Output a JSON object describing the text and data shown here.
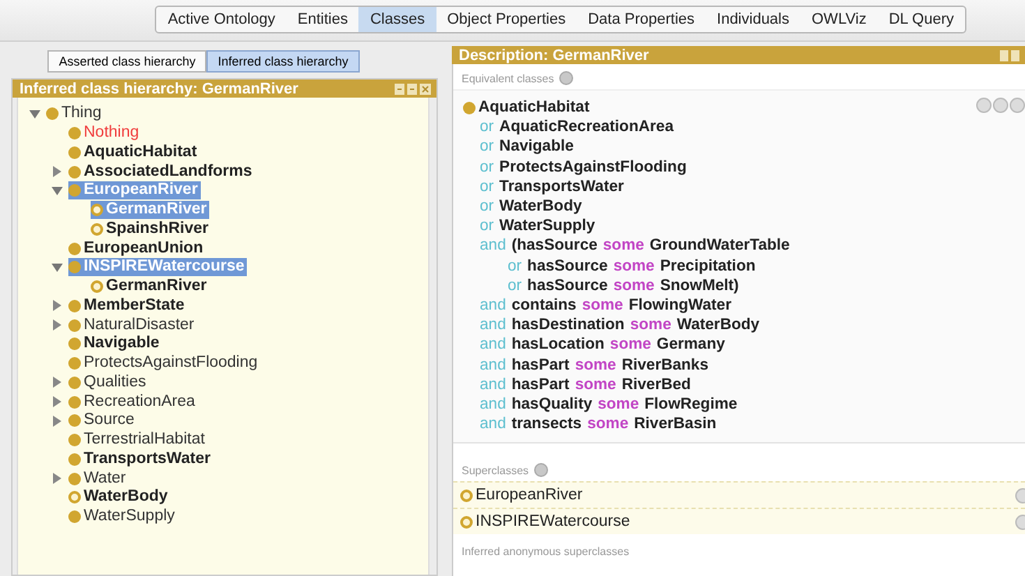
{
  "tabs": [
    {
      "label": "Active Ontology",
      "selected": false
    },
    {
      "label": "Entities",
      "selected": false
    },
    {
      "label": "Classes",
      "selected": true
    },
    {
      "label": "Object Properties",
      "selected": false
    },
    {
      "label": "Data Properties",
      "selected": false
    },
    {
      "label": "Individuals",
      "selected": false
    },
    {
      "label": "OWLViz",
      "selected": false
    },
    {
      "label": "DL Query",
      "selected": false
    }
  ],
  "left": {
    "view_buttons": [
      {
        "label": "Asserted class hierarchy",
        "selected": false
      },
      {
        "label": "Inferred class hierarchy",
        "selected": true
      }
    ],
    "title": "Inferred class hierarchy: GermanRiver",
    "tree": [
      {
        "label": "Thing",
        "kind": "class",
        "bold": false,
        "defined": false,
        "selected": false,
        "expanded": true,
        "children": [
          {
            "label": "Nothing",
            "kind": "nothing",
            "bold": false,
            "defined": false,
            "selected": false
          },
          {
            "label": "AquaticHabitat",
            "kind": "class",
            "bold": true,
            "defined": false,
            "selected": false
          },
          {
            "label": "AssociatedLandforms",
            "kind": "class",
            "bold": true,
            "defined": false,
            "selected": false,
            "expanded": false
          },
          {
            "label": "EuropeanRiver",
            "kind": "class",
            "bold": true,
            "defined": false,
            "selected": true,
            "expanded": true,
            "children": [
              {
                "label": "GermanRiver",
                "kind": "class",
                "bold": true,
                "defined": true,
                "selected": true
              },
              {
                "label": "SpainshRiver",
                "kind": "class",
                "bold": true,
                "defined": true,
                "selected": false
              }
            ]
          },
          {
            "label": "EuropeanUnion",
            "kind": "class",
            "bold": true,
            "defined": false,
            "selected": false
          },
          {
            "label": "INSPIREWatercourse",
            "kind": "class",
            "bold": true,
            "defined": false,
            "selected": true,
            "expanded": true,
            "children": [
              {
                "label": "GermanRiver",
                "kind": "class",
                "bold": true,
                "defined": true,
                "selected": false
              }
            ]
          },
          {
            "label": "MemberState",
            "kind": "class",
            "bold": true,
            "defined": false,
            "selected": false,
            "expanded": false
          },
          {
            "label": "NaturalDisaster",
            "kind": "class",
            "bold": false,
            "defined": false,
            "selected": false,
            "expanded": false
          },
          {
            "label": "Navigable",
            "kind": "class",
            "bold": true,
            "defined": false,
            "selected": false
          },
          {
            "label": "ProtectsAgainstFlooding",
            "kind": "class",
            "bold": false,
            "defined": false,
            "selected": false
          },
          {
            "label": "Qualities",
            "kind": "class",
            "bold": false,
            "defined": false,
            "selected": false,
            "expanded": false
          },
          {
            "label": "RecreationArea",
            "kind": "class",
            "bold": false,
            "defined": false,
            "selected": false,
            "expanded": false
          },
          {
            "label": "Source",
            "kind": "class",
            "bold": false,
            "defined": false,
            "selected": false,
            "expanded": false
          },
          {
            "label": "TerrestrialHabitat",
            "kind": "class",
            "bold": false,
            "defined": false,
            "selected": false
          },
          {
            "label": "TransportsWater",
            "kind": "class",
            "bold": true,
            "defined": false,
            "selected": false
          },
          {
            "label": "Water",
            "kind": "class",
            "bold": false,
            "defined": false,
            "selected": false,
            "expanded": false
          },
          {
            "label": "WaterBody",
            "kind": "class",
            "bold": true,
            "defined": true,
            "selected": false
          },
          {
            "label": "WaterSupply",
            "kind": "class",
            "bold": false,
            "defined": false,
            "selected": false
          }
        ]
      }
    ]
  },
  "right": {
    "title": "Description: GermanRiver",
    "equivalent": {
      "label": "Equivalent classes",
      "lines": [
        {
          "kind": "head",
          "parts": [
            {
              "text": "AquaticHabitat",
              "kind": "name"
            }
          ]
        },
        {
          "kind": "main",
          "parts": [
            {
              "text": "or",
              "kind": "keyword"
            },
            {
              "text": "AquaticRecreationArea",
              "kind": "name"
            }
          ]
        },
        {
          "kind": "main",
          "parts": [
            {
              "text": "or",
              "kind": "keyword"
            },
            {
              "text": "Navigable",
              "kind": "name"
            }
          ]
        },
        {
          "kind": "main",
          "parts": [
            {
              "text": "or",
              "kind": "keyword"
            },
            {
              "text": "ProtectsAgainstFlooding",
              "kind": "name"
            }
          ]
        },
        {
          "kind": "main",
          "parts": [
            {
              "text": "or",
              "kind": "keyword"
            },
            {
              "text": "TransportsWater",
              "kind": "name"
            }
          ]
        },
        {
          "kind": "main",
          "parts": [
            {
              "text": "or",
              "kind": "keyword"
            },
            {
              "text": "WaterBody",
              "kind": "name"
            }
          ]
        },
        {
          "kind": "main",
          "parts": [
            {
              "text": "or",
              "kind": "keyword"
            },
            {
              "text": "WaterSupply",
              "kind": "name"
            }
          ]
        },
        {
          "kind": "main",
          "parts": [
            {
              "text": "and",
              "kind": "keyword"
            },
            {
              "text": "(hasSource",
              "kind": "name"
            },
            {
              "text": "some",
              "kind": "quantifier"
            },
            {
              "text": "GroundWaterTable",
              "kind": "name"
            }
          ]
        },
        {
          "kind": "sub",
          "parts": [
            {
              "text": "or",
              "kind": "keyword"
            },
            {
              "text": "hasSource",
              "kind": "name"
            },
            {
              "text": "some",
              "kind": "quantifier"
            },
            {
              "text": "Precipitation",
              "kind": "name"
            }
          ]
        },
        {
          "kind": "sub",
          "parts": [
            {
              "text": "or",
              "kind": "keyword"
            },
            {
              "text": "hasSource",
              "kind": "name"
            },
            {
              "text": "some",
              "kind": "quantifier"
            },
            {
              "text": "SnowMelt)",
              "kind": "name"
            }
          ]
        },
        {
          "kind": "main",
          "parts": [
            {
              "text": "and",
              "kind": "keyword"
            },
            {
              "text": "contains",
              "kind": "name"
            },
            {
              "text": "some",
              "kind": "quantifier"
            },
            {
              "text": "FlowingWater",
              "kind": "name"
            }
          ]
        },
        {
          "kind": "main",
          "parts": [
            {
              "text": "and",
              "kind": "keyword"
            },
            {
              "text": "hasDestination",
              "kind": "name"
            },
            {
              "text": "some",
              "kind": "quantifier"
            },
            {
              "text": "WaterBody",
              "kind": "name"
            }
          ]
        },
        {
          "kind": "main",
          "parts": [
            {
              "text": "and",
              "kind": "keyword"
            },
            {
              "text": "hasLocation",
              "kind": "name"
            },
            {
              "text": "some",
              "kind": "quantifier"
            },
            {
              "text": "Germany",
              "kind": "name"
            }
          ]
        },
        {
          "kind": "main",
          "parts": [
            {
              "text": "and",
              "kind": "keyword"
            },
            {
              "text": "hasPart",
              "kind": "name"
            },
            {
              "text": "some",
              "kind": "quantifier"
            },
            {
              "text": "RiverBanks",
              "kind": "name"
            }
          ]
        },
        {
          "kind": "main",
          "parts": [
            {
              "text": "and",
              "kind": "keyword"
            },
            {
              "text": "hasPart",
              "kind": "name"
            },
            {
              "text": "some",
              "kind": "quantifier"
            },
            {
              "text": "RiverBed",
              "kind": "name"
            }
          ]
        },
        {
          "kind": "main",
          "parts": [
            {
              "text": "and",
              "kind": "keyword"
            },
            {
              "text": "hasQuality",
              "kind": "name"
            },
            {
              "text": "some",
              "kind": "quantifier"
            },
            {
              "text": "FlowRegime",
              "kind": "name"
            }
          ]
        },
        {
          "kind": "main",
          "parts": [
            {
              "text": "and",
              "kind": "keyword"
            },
            {
              "text": "transects",
              "kind": "name"
            },
            {
              "text": "some",
              "kind": "quantifier"
            },
            {
              "text": "RiverBasin",
              "kind": "name"
            }
          ]
        }
      ]
    },
    "superclasses": {
      "label": "Superclasses",
      "items": [
        {
          "label": "EuropeanRiver"
        },
        {
          "label": "INSPIREWatercourse"
        }
      ]
    },
    "inferred_label": "Inferred anonymous superclasses"
  }
}
